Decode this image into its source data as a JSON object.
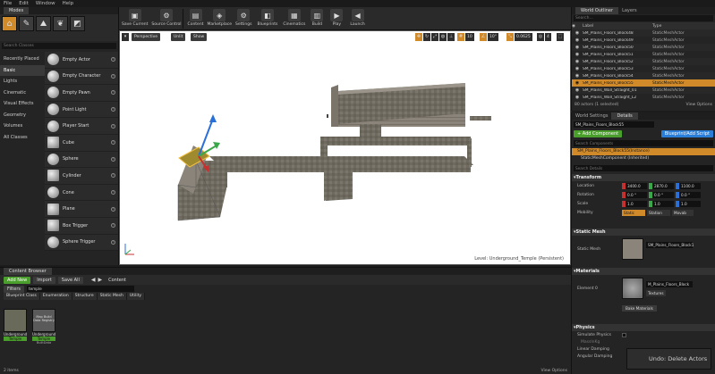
{
  "menu": [
    "File",
    "Edit",
    "Window",
    "Help"
  ],
  "modes": {
    "tab": "Modes",
    "search_placeholder": "Search Classes",
    "categories": [
      "Recently Placed",
      "Basic",
      "Lights",
      "Cinematic",
      "Visual Effects",
      "Geometry",
      "Volumes",
      "All Classes"
    ],
    "selected_category": "Basic",
    "items": [
      "Empty Actor",
      "Empty Character",
      "Empty Pawn",
      "Point Light",
      "Player Start",
      "Cube",
      "Sphere",
      "Cylinder",
      "Cone",
      "Plane",
      "Box Trigger",
      "Sphere Trigger"
    ]
  },
  "toolbar": {
    "buttons": [
      {
        "label": "Save Current",
        "icon": "save-icon"
      },
      {
        "label": "Source Control",
        "icon": "source-control-icon"
      },
      {
        "label": "Content",
        "icon": "content-icon"
      },
      {
        "label": "Marketplace",
        "icon": "marketplace-icon"
      },
      {
        "label": "Settings",
        "icon": "settings-icon"
      },
      {
        "label": "Blueprints",
        "icon": "blueprints-icon"
      },
      {
        "label": "Cinematics",
        "icon": "cinematics-icon"
      },
      {
        "label": "Build",
        "icon": "build-icon"
      },
      {
        "label": "Play",
        "icon": "play-icon"
      },
      {
        "label": "Launch",
        "icon": "launch-icon"
      }
    ]
  },
  "viewport": {
    "perspective": "Perspective",
    "lit": "Unlit",
    "show": "Show",
    "grid_snap": "10",
    "rot_snap": "10°",
    "scale_snap": "0.0625",
    "cam_speed": "4",
    "level_label": "Level:",
    "level_name": "Underground_Temple (Persistent)"
  },
  "outliner": {
    "tabs": [
      "World Outliner",
      "Layers"
    ],
    "search_placeholder": "Search...",
    "col_label": "Label",
    "col_type": "Type",
    "rows": [
      {
        "name": "SM_Plains_Floors_Block48",
        "type": "StaticMeshActor"
      },
      {
        "name": "SM_Plains_Floors_Block49",
        "type": "StaticMeshActor"
      },
      {
        "name": "SM_Plains_Floors_Block50",
        "type": "StaticMeshActor"
      },
      {
        "name": "SM_Plains_Floors_Block51",
        "type": "StaticMeshActor"
      },
      {
        "name": "SM_Plains_Floors_Block52",
        "type": "StaticMeshActor"
      },
      {
        "name": "SM_Plains_Floors_Block53",
        "type": "StaticMeshActor"
      },
      {
        "name": "SM_Plains_Floors_Block54",
        "type": "StaticMeshActor"
      },
      {
        "name": "SM_Plains_Floors_Block55",
        "type": "StaticMeshActor"
      },
      {
        "name": "SM_Plains_Wall_Straight_01",
        "type": "StaticMeshActor"
      },
      {
        "name": "SM_Plains_Wall_Straight_L2",
        "type": "StaticMeshActor"
      }
    ],
    "selected_index": 7,
    "footer_count": "80 actors (1 selected)",
    "view_options": "View Options"
  },
  "details": {
    "tabs": [
      "World Settings",
      "Details"
    ],
    "name_field": "SM_Plains_Floors_Block55",
    "add_component": "+ Add Component",
    "blueprint_script": "Blueprint/Add Script",
    "search_components": "Search Components",
    "component_instance": "SM_Plains_Floors_Block55(Instance)",
    "component_inherited": "StaticMeshComponent (Inherited)",
    "search_details": "Search Details",
    "transform_header": "Transform",
    "location_label": "Location",
    "location": [
      "3400.0",
      "2870.0",
      "1100.0"
    ],
    "rotation_label": "Rotation",
    "rotation": [
      "0.0 °",
      "0.0 °",
      "0.0 °"
    ],
    "scale_label": "Scale",
    "scale": [
      "1.0",
      "1.0",
      "1.0"
    ],
    "mobility_label": "Mobility",
    "mobility_options": [
      "Static",
      "Station",
      "Movab"
    ],
    "static_mesh_header": "Static Mesh",
    "static_mesh_label": "Static Mesh",
    "static_mesh_value": "SM_Plains_Floors_Block1",
    "materials_header": "Materials",
    "element_label": "Element 0",
    "element_value": "M_Plains_Floors_Block",
    "textures": "Textures",
    "bake_materials": "Bake Materials",
    "physics_header": "Physics",
    "simulate_physics": "Simulate Physics",
    "mass_kg": "MassInKg",
    "linear_damping": "Linear Damping",
    "angular_damping": "Angular Damping"
  },
  "content_browser": {
    "tab": "Content Browser",
    "add_new": "Add New",
    "import": "Import",
    "save_all": "Save All",
    "path": "Content",
    "filters": "Filters",
    "search_value": "temple",
    "filter_chips": [
      "Blueprint Class",
      "Enumeration",
      "Structure",
      "Static Mesh",
      "Utility"
    ],
    "assets": [
      {
        "name": "Underground",
        "tag": "Temple",
        "thumb": "",
        "bottom": ""
      },
      {
        "name": "Underground",
        "tag": "Temple",
        "thumb": "Map Build Data Registry",
        "bottom": "BuiltData"
      }
    ],
    "footer_count": "2 items",
    "view_options": "View Options"
  },
  "toast": "Undo: Delete Actors"
}
